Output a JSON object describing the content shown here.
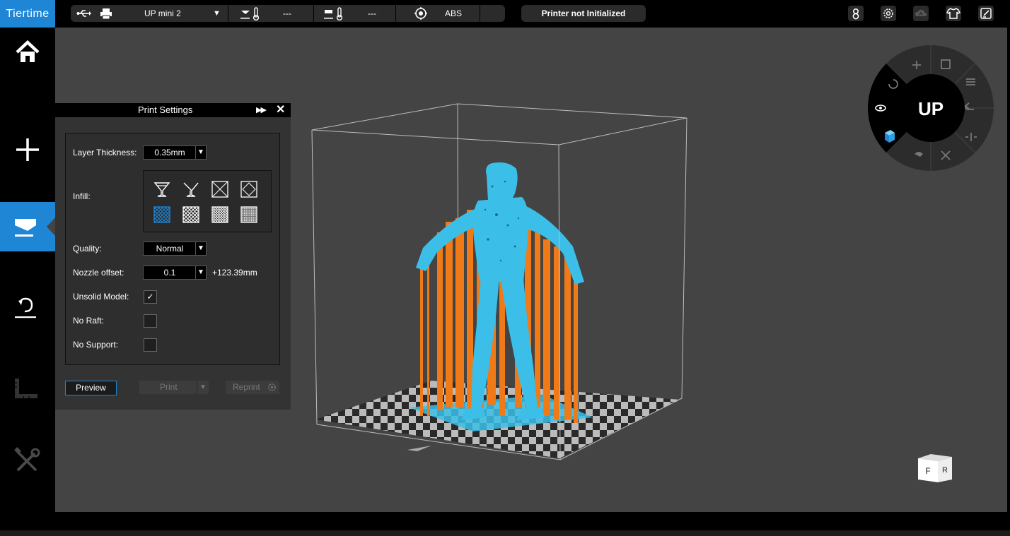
{
  "app": {
    "logo": "Tiertime"
  },
  "toolbar": {
    "printer_name": "UP mini 2",
    "nozzle_temp": "---",
    "bed_temp": "---",
    "material": "ABS",
    "status": "Printer not Initialized",
    "icons": [
      "usb-icon",
      "printer-icon",
      "nozzle-thermometer-icon",
      "bed-thermometer-icon",
      "material-target-icon",
      "account-icon",
      "settings-icon",
      "cloud-upload-icon",
      "shirt-icon",
      "edit-icon"
    ]
  },
  "sidebar": {
    "items": [
      {
        "name": "home",
        "icon": "home-icon",
        "active": false
      },
      {
        "name": "add",
        "icon": "plus-icon",
        "active": false
      },
      {
        "name": "print",
        "icon": "print-icon",
        "active": true
      },
      {
        "name": "calibrate",
        "icon": "calibrate-icon",
        "active": false
      },
      {
        "name": "measure",
        "icon": "ruler-icon",
        "active": false
      },
      {
        "name": "maintenance",
        "icon": "tools-icon",
        "active": false
      }
    ]
  },
  "print_settings": {
    "title": "Print Settings",
    "layer_thickness_label": "Layer Thickness:",
    "layer_thickness_value": "0.35mm",
    "infill_label": "Infill:",
    "infill_selected_index": 4,
    "quality_label": "Quality:",
    "quality_value": "Normal",
    "nozzle_offset_label": "Nozzle offset:",
    "nozzle_offset_value": "0.1",
    "nozzle_offset_height": "+123.39mm",
    "unsolid_model_label": "Unsolid Model:",
    "unsolid_model_checked": true,
    "unsolid_model_mark": "✓",
    "no_raft_label": "No Raft:",
    "no_raft_checked": false,
    "no_support_label": "No Support:",
    "no_support_checked": false,
    "preview_label": "Preview",
    "print_label": "Print",
    "reprint_label": "Reprint"
  },
  "view_wheel": {
    "center_label": "UP"
  },
  "view_cube": {
    "front": "F",
    "right": "R"
  },
  "colors": {
    "accent": "#1f86d6",
    "model": "#3bbfe8",
    "support": "#f07a18",
    "viewport": "#444444"
  }
}
